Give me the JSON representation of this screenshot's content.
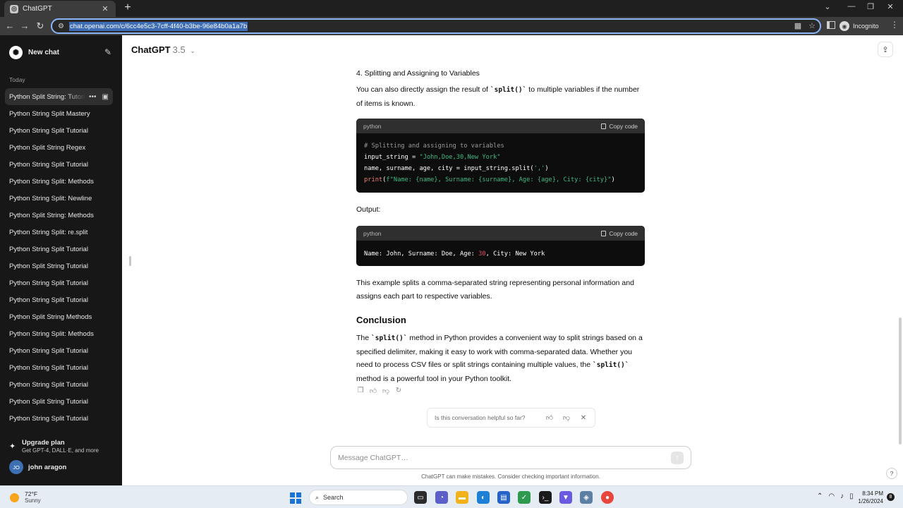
{
  "browser": {
    "tab_title": "ChatGPT",
    "url": "chat.openai.com/c/6cc4e5c3-7cff-4f40-b3be-96e84b0a1a7b",
    "profile_label": "Incognito"
  },
  "sidebar": {
    "new_chat_label": "New chat",
    "section_label": "Today",
    "chats": [
      {
        "label": "Python Split String: Tutorial"
      },
      {
        "label": "Python String Split Mastery"
      },
      {
        "label": "Python String Split Tutorial"
      },
      {
        "label": "Python Split String Regex"
      },
      {
        "label": "Python String Split Tutorial"
      },
      {
        "label": "Python String Split: Methods"
      },
      {
        "label": "Python String Split: Newline"
      },
      {
        "label": "Python Split String: Methods"
      },
      {
        "label": "Python String Split: re.split"
      },
      {
        "label": "Python String Split Tutorial"
      },
      {
        "label": "Python Split String Tutorial"
      },
      {
        "label": "Python String Split Tutorial"
      },
      {
        "label": "Python String Split Tutorial"
      },
      {
        "label": "Python Split String Methods"
      },
      {
        "label": "Python String Split: Methods"
      },
      {
        "label": "Python String Split Tutorial"
      },
      {
        "label": "Python String Split Tutorial"
      },
      {
        "label": "Python String Split Tutorial"
      },
      {
        "label": "Python Split String Tutorial"
      },
      {
        "label": "Python String Split Tutorial"
      }
    ],
    "upgrade_title": "Upgrade plan",
    "upgrade_subtitle": "Get GPT-4, DALL·E, and more",
    "user_initials": "JO",
    "user_name": "john aragon"
  },
  "header": {
    "model_name": "ChatGPT",
    "model_version": "3.5"
  },
  "message": {
    "heading4": "4. Splitting and Assigning to Variables",
    "para1_pre": "You can also directly assign the result of ",
    "para1_code": "`split()`",
    "para1_post": " to multiple variables if the number of items is known.",
    "code1": {
      "lang": "python",
      "copy_label": "Copy code",
      "line1": "# Splitting and assigning to variables",
      "line2_a": "input_string = ",
      "line2_b": "\"John,Doe,30,New York\"",
      "line3_a": "name, surname, age, city = input_string.split(",
      "line3_b": "','",
      "line3_c": ")",
      "line4_a": "print",
      "line4_b": "(",
      "line4_c": "f\"Name: {name}, Surname: {surname}, Age: {age}, City: {city}\"",
      "line4_d": ")"
    },
    "output_label": "Output:",
    "code2": {
      "lang": "python",
      "copy_label": "Copy code",
      "out_a": "Name: John, Surname: Doe, Age: ",
      "out_b": "30",
      "out_c": ", City: New York"
    },
    "para2": "This example splits a comma-separated string representing personal information and assigns each part to respective variables.",
    "conclusion_heading": "Conclusion",
    "para3_a": "The ",
    "para3_code1": "`split()`",
    "para3_b": " method in Python provides a convenient way to split strings based on a specified delimiter, making it easy to work with comma-separated data. Whether you need to process CSV files or split strings containing multiple values, the ",
    "para3_code2": "`split()`",
    "para3_c": " method is a powerful tool in your Python toolkit."
  },
  "helpful_prompt": "Is this conversation helpful so far?",
  "composer": {
    "placeholder": "Message ChatGPT…"
  },
  "disclaimer": "ChatGPT can make mistakes. Consider checking important information.",
  "help_label": "?",
  "taskbar": {
    "temp": "72°F",
    "condition": "Sunny",
    "search_label": "Search",
    "time": "8:34 PM",
    "date": "1/26/2024",
    "notification_count": "8"
  }
}
